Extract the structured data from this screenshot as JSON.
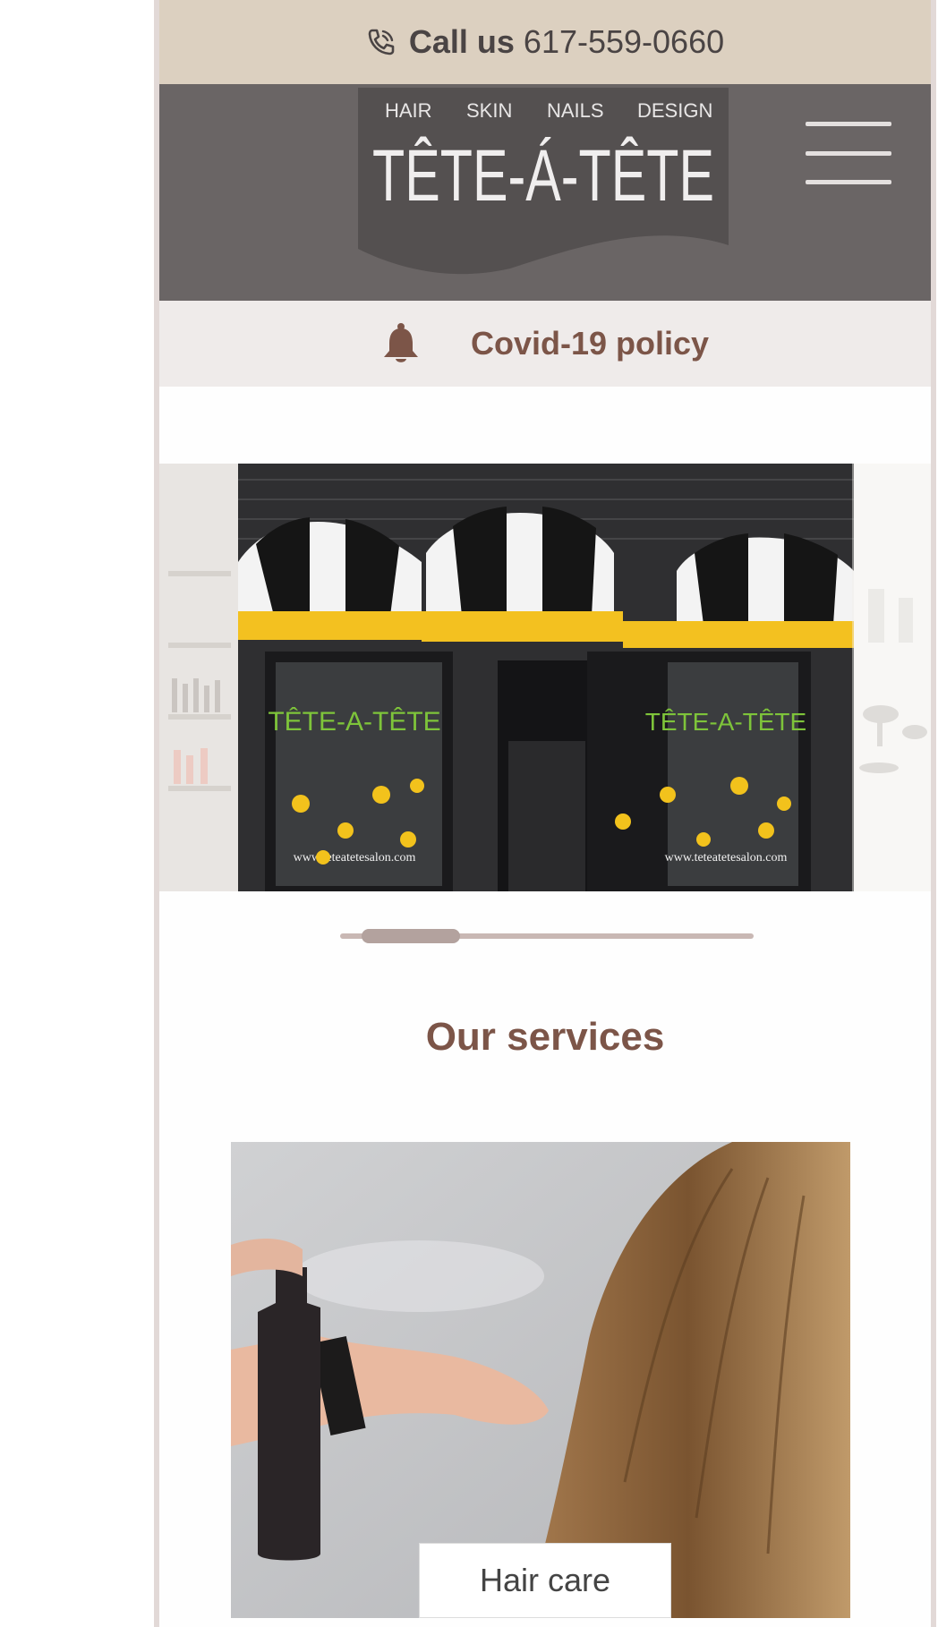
{
  "top_bar": {
    "call_label": "Call us",
    "phone_number": "617-559-0660",
    "icon": "phone-icon"
  },
  "header": {
    "logo": {
      "categories": [
        "HAIR",
        "SKIN",
        "NAILS",
        "DESIGN"
      ],
      "name": "TÊTE-Á-TÊTE"
    },
    "menu_icon": "hamburger-icon"
  },
  "notice": {
    "label": "Covid-19 policy",
    "icon": "bell-icon"
  },
  "slider": {
    "active_index": 0,
    "slides": [
      {
        "sign_text": "TÊTE-A-TÊTE",
        "window_text": "www.teteatetesalon.com"
      }
    ]
  },
  "services": {
    "title": "Our services",
    "items": [
      {
        "label": "Hair care"
      }
    ]
  },
  "colors": {
    "call_bar": "#dcd0c0",
    "header": "#6a6565",
    "covid_bar": "#efebea",
    "accent_brown": "#7c5548"
  }
}
